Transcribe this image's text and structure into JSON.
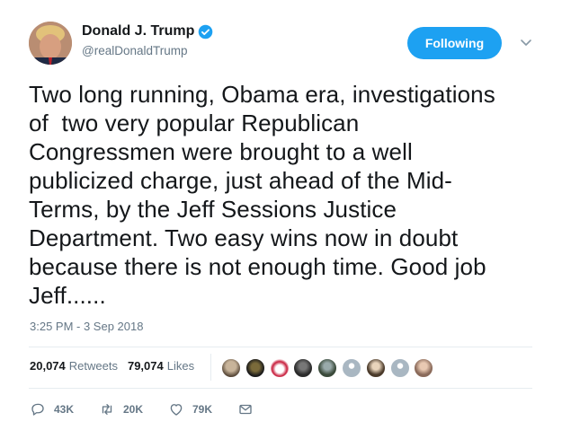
{
  "author": {
    "display_name": "Donald J. Trump",
    "handle": "@realDonaldTrump",
    "verified": true
  },
  "follow_button": {
    "label": "Following"
  },
  "tweet": {
    "text": "Two long running, Obama era, investigations\nof  two very popular Republican\nCongressmen were brought to a well\npublicized charge, just ahead of the Mid-\nTerms, by the Jeff Sessions Justice\nDepartment. Two easy wins now in doubt\nbecause there is not enough time. Good job\nJeff......",
    "timestamp": "3:25 PM - 3 Sep 2018"
  },
  "stats": {
    "retweets_count": "20,074",
    "retweets_label": "Retweets",
    "likes_count": "79,074",
    "likes_label": "Likes"
  },
  "liker_avatars": [
    "avatar-1",
    "avatar-2",
    "avatar-3",
    "avatar-4",
    "avatar-5",
    "avatar-6",
    "avatar-7",
    "avatar-8",
    "avatar-9"
  ],
  "actions": {
    "reply_count": "43K",
    "retweet_count": "20K",
    "like_count": "79K"
  },
  "colors": {
    "accent": "#1da1f2",
    "text": "#14171a",
    "muted": "#657786",
    "divider": "#e6ecf0"
  }
}
